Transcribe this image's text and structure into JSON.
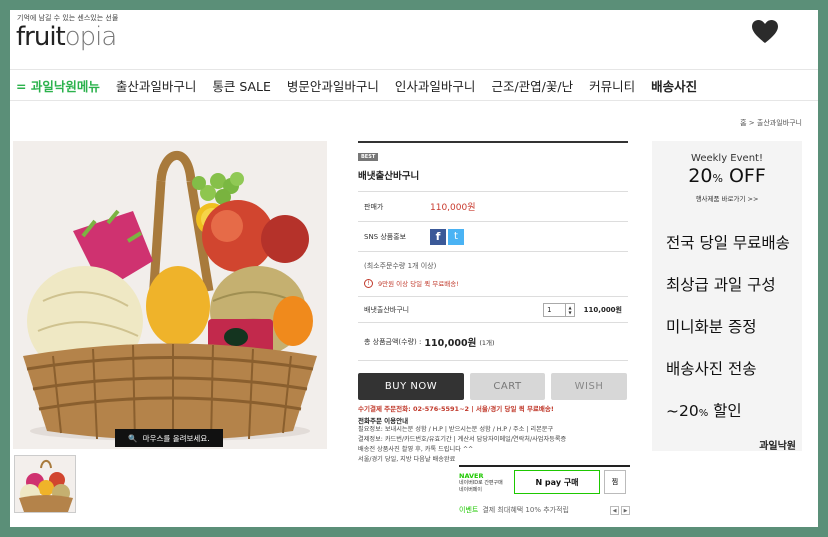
{
  "header": {
    "tagline": "기억에 남길 수 있는 센스있는 선물",
    "logo_part1": "fruit",
    "logo_part2": "opia"
  },
  "nav": {
    "items": [
      {
        "label": "= 과일낙원메뉴"
      },
      {
        "label": "출산과일바구니"
      },
      {
        "label": "통큰 SALE"
      },
      {
        "label": "병문안과일바구니"
      },
      {
        "label": "인사과일바구니"
      },
      {
        "label": "근조/관엽/꽃/난"
      },
      {
        "label": "커뮤니티"
      },
      {
        "label": "배송사진"
      }
    ]
  },
  "breadcrumb": {
    "home": "홈",
    "sep": ">",
    "current": "출산과일바구니"
  },
  "gallery": {
    "zoom_hint": "마우스를 올려보세요."
  },
  "product": {
    "badge": "BEST",
    "name": "배냇출산바구니",
    "price_label": "판매가",
    "price": "110,000원",
    "sns_label": "SNS 상품홍보",
    "min_qty": "(최소주문수량 1개 이상)",
    "notice_icon": "!",
    "notice": "9만원 이상 당일 퀵 무료배송!",
    "option_name": "배냇출산바구니",
    "option_qty": "1",
    "option_price": "110,000원",
    "total_label": "총 상품금액(수량) :",
    "total_value": "110,000원",
    "total_count": "(1개)"
  },
  "buttons": {
    "buy": "BUY NOW",
    "cart": "CART",
    "wish": "WISH"
  },
  "contact": {
    "phone": "수기결제 주문전화: 02-576-5591~2 | 서울/경기 당일 퀵 무료배송!",
    "guide_title": "전화주문 이용안내",
    "guide_lines": [
      "필요정보: 보내시는분 성함 / H.P  |  받으시는분 성함 / H.P / 주소  |  리본문구",
      "결제정보: 카드번/카드번호/유효기간  |  계산서 담당자이메일/연락처/사업자등록증",
      "배송전 상품사진 촬영 후, 카톡 드립니다 ^^",
      "서울/경기 당일, 지방 다음날 배송완료"
    ]
  },
  "naver": {
    "logo": "NAVER",
    "desc1": "네이버ID로 간편구매",
    "desc2": "네이버페이",
    "pay": "N pay 구매",
    "jjim": "찜",
    "event_label": "이벤트",
    "event_text": "결제 최대혜택 10% 추가적립"
  },
  "promo": {
    "weekly": "Weekly Event!",
    "off_num": "20",
    "off_pct": "%",
    "off_word": "OFF",
    "link": "행사제품 바로가기 >>",
    "lines": [
      "전국 당일 무료배송",
      "최상급 과일 구성",
      "미니화분 증정",
      "배송사진 전송"
    ],
    "discount_prefix": "~20",
    "discount_pct": "%",
    "discount_suffix": "할인",
    "brand": "과일낙원"
  }
}
